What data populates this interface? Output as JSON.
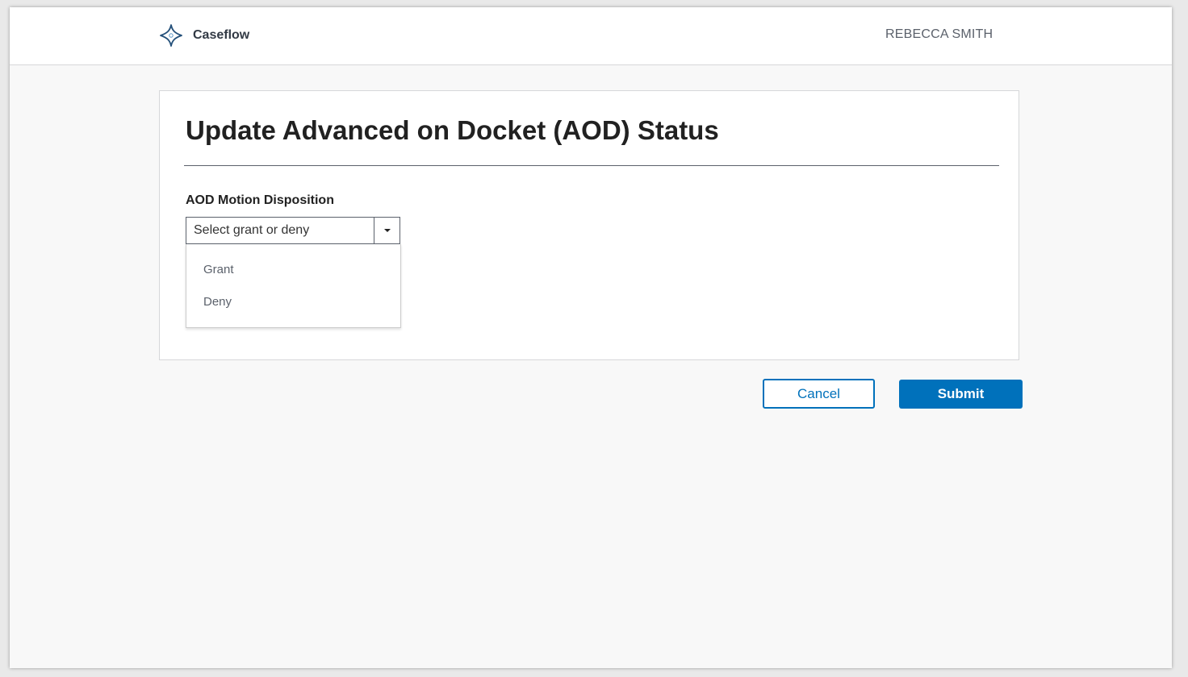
{
  "header": {
    "app_name": "Caseflow",
    "logo_icon": "caseflow-star-icon",
    "user_name": "REBECCA SMITH"
  },
  "form": {
    "title": "Update Advanced on Docket (AOD) Status",
    "disposition": {
      "label": "AOD Motion Disposition",
      "placeholder": "Select grant or deny",
      "indicator_icon": "chevron-down-icon",
      "options": [
        "Grant",
        "Deny"
      ]
    }
  },
  "actions": {
    "cancel_label": "Cancel",
    "submit_label": "Submit"
  },
  "colors": {
    "accent": "#0071bb",
    "heading": "#212121",
    "muted_text": "#5b616b",
    "page_background": "#f8f8f8"
  }
}
